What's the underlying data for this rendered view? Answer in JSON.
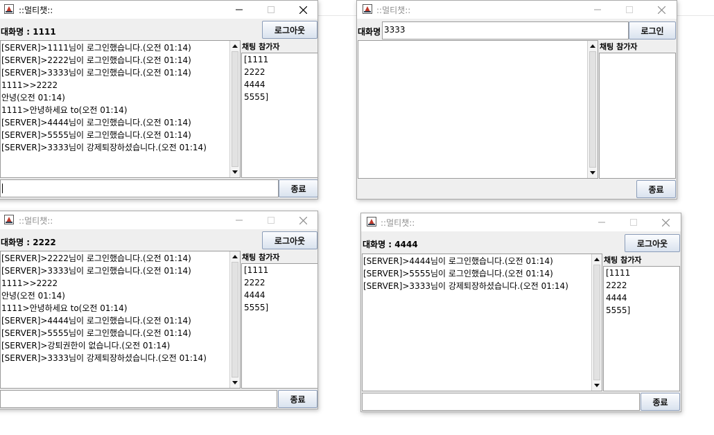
{
  "common": {
    "participants_label": "채팅 참가자",
    "close_label": "종료"
  },
  "windows": [
    {
      "id": "win1111",
      "title": "::멀티챗::",
      "name_label": "대화명 : 1111",
      "action_label": "로그아웃",
      "messages": [
        "[SERVER]>1111님이 로그인했습니다.(오전 01:14)",
        "[SERVER]>2222님이 로그인했습니다.(오전 01:14)",
        "[SERVER]>3333님이 로그인했습니다.(오전 01:14)",
        "1111>>2222",
        "안녕(오전 01:14)",
        "1111>안녕하세요 to(오전 01:14)",
        "[SERVER]>4444님이 로그인했습니다.(오전 01:14)",
        "[SERVER]>5555님이 로그인했습니다.(오전 01:14)",
        "[SERVER]>3333님이 강제퇴장하셨습니다.(오전 01:14)"
      ],
      "participants": [
        "[1111",
        "2222",
        "4444",
        "5555]"
      ],
      "input_value": ""
    },
    {
      "id": "win3333",
      "title": "::멀티챗::",
      "name_label": "대화명",
      "name_value": "3333",
      "action_label": "로그인",
      "messages": [],
      "participants": []
    },
    {
      "id": "win2222",
      "title": "::멀티챗::",
      "name_label": "대화명 : 2222",
      "action_label": "로그아웃",
      "messages": [
        "[SERVER]>2222님이 로그인했습니다.(오전 01:14)",
        "[SERVER]>3333님이 로그인했습니다.(오전 01:14)",
        "1111>>2222",
        "안녕(오전 01:14)",
        "1111>안녕하세요 to(오전 01:14)",
        "[SERVER]>4444님이 로그인했습니다.(오전 01:14)",
        "[SERVER]>5555님이 로그인했습니다.(오전 01:14)",
        "[SERVER]>강퇴권한이 없습니다.(오전 01:14)",
        "[SERVER]>3333님이 강제퇴장하셨습니다.(오전 01:14)"
      ],
      "participants": [
        "[1111",
        "2222",
        "4444",
        "5555]"
      ],
      "input_value": ""
    },
    {
      "id": "win4444",
      "title": "::멀티챗::",
      "name_label": "대화명 : 4444",
      "action_label": "로그아웃",
      "messages": [
        "[SERVER]>4444님이 로그인했습니다.(오전 01:14)",
        "[SERVER]>5555님이 로그인했습니다.(오전 01:14)",
        "[SERVER]>3333님이 강제퇴장하셨습니다.(오전 01:14)"
      ],
      "participants": [
        "[1111",
        "2222",
        "4444",
        "5555]"
      ],
      "input_value": ""
    }
  ]
}
